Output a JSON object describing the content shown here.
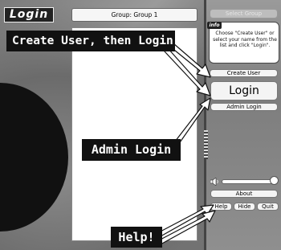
{
  "window": {
    "title": "Login",
    "group_label": "Group: Group 1"
  },
  "side_panel": {
    "select_group_label": "Select Group",
    "info_badge": "info",
    "info_text": "Choose \"Create User\" or select your name from the list and click \"Login\".",
    "create_user_label": "Create User",
    "login_label": "Login",
    "admin_login_label": "Admin Login",
    "volume_level": 1.0,
    "about_label": "About",
    "help_label": "Help",
    "hide_label": "Hide",
    "quit_label": "Quit"
  },
  "user_list": {
    "items": []
  },
  "callouts": {
    "create_user_then_login": "Create User, then Login",
    "admin_login": "Admin Login",
    "help": "Help!"
  },
  "colors": {
    "callout_bg": "#111111",
    "callout_text": "#ffffff",
    "button_bg": "#f4f4f4"
  }
}
